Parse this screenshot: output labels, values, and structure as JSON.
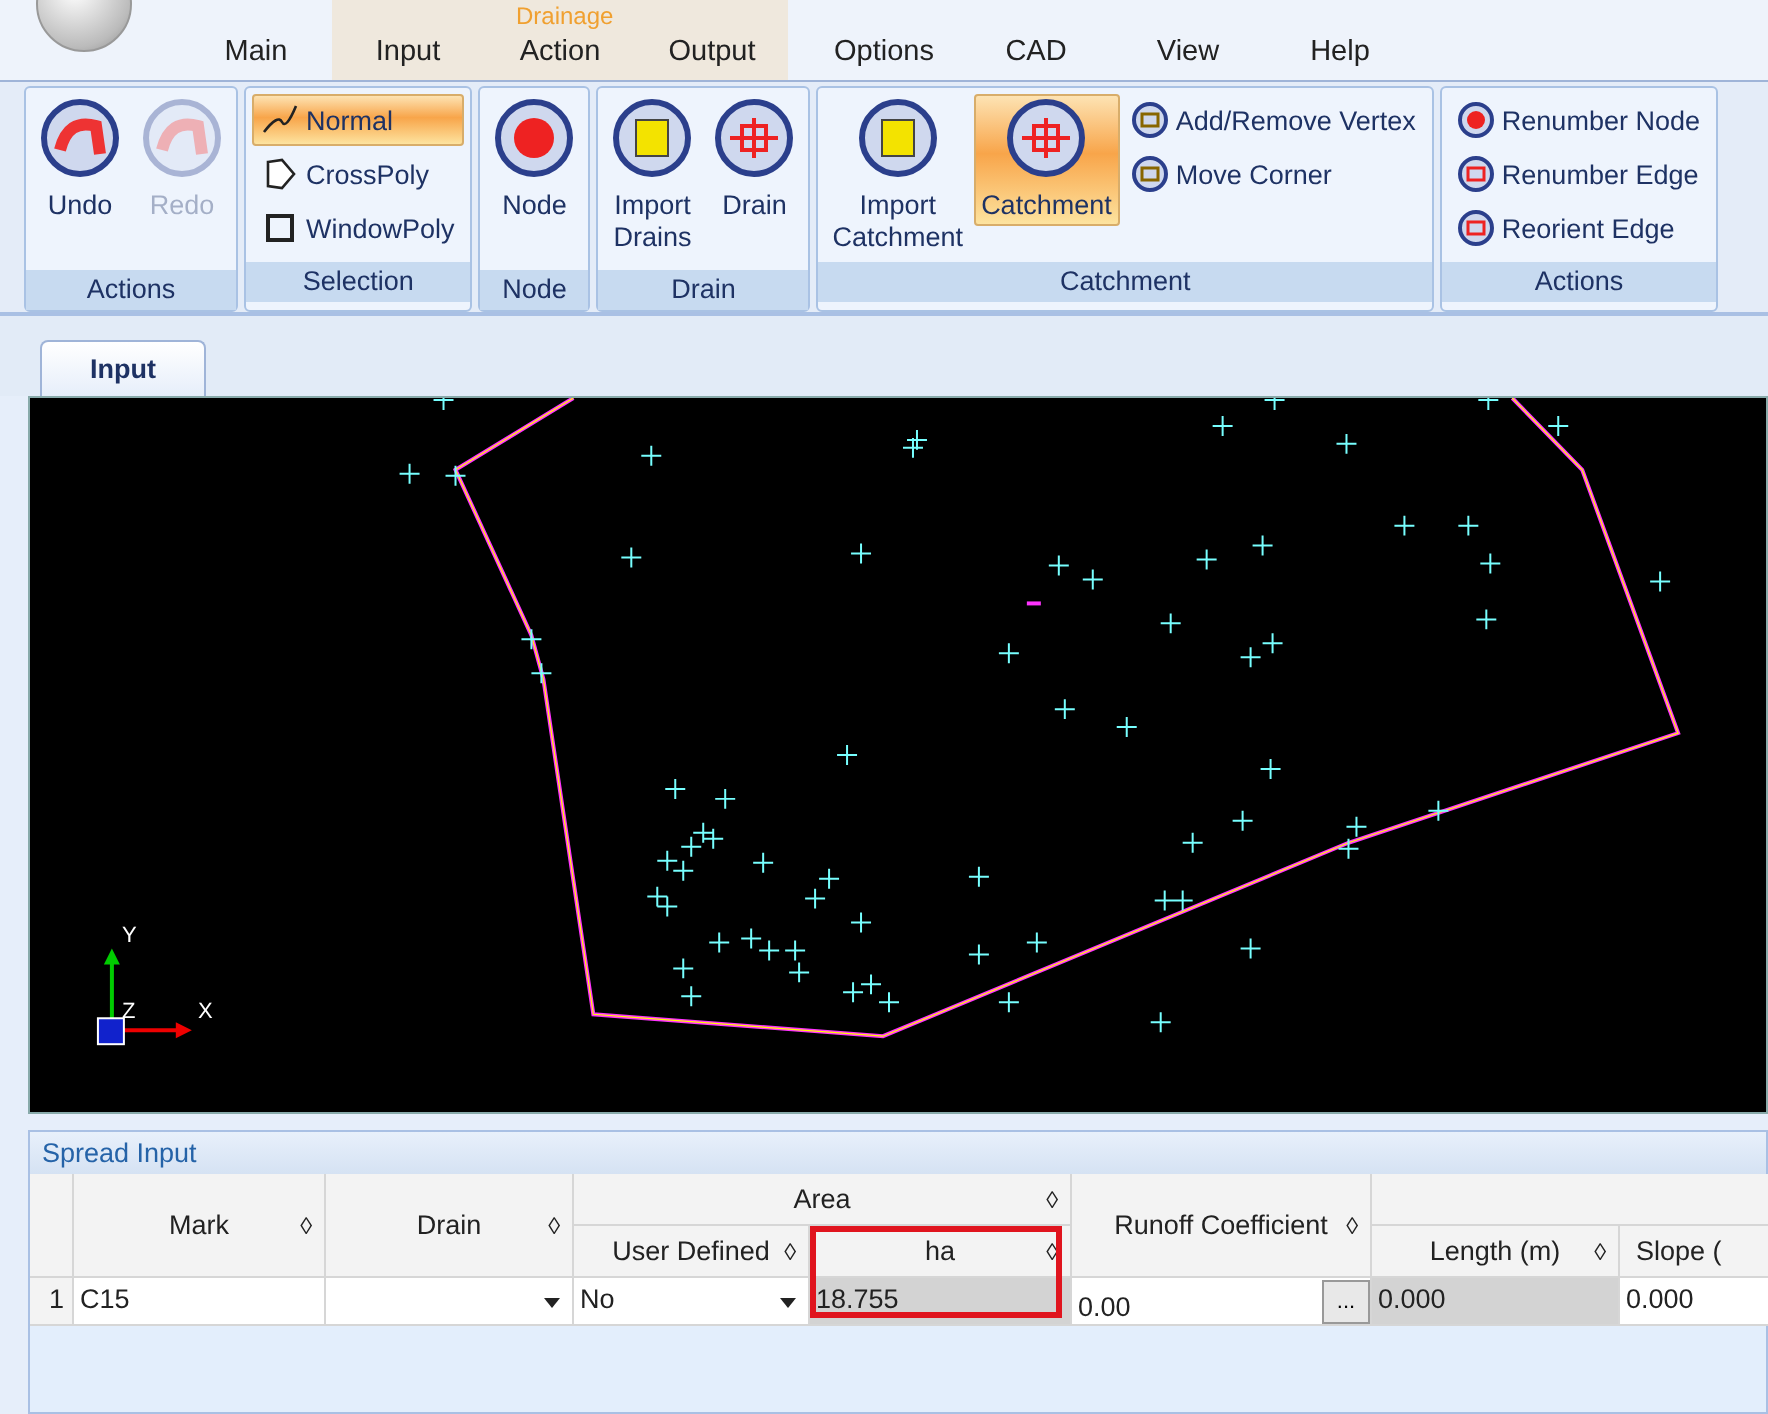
{
  "app": {
    "context_label": "Drainage"
  },
  "menu": [
    {
      "label": "Main",
      "contextual": false,
      "selected": false
    },
    {
      "label": "Input",
      "contextual": true,
      "selected": false
    },
    {
      "label": "Action",
      "contextual": true,
      "selected": false
    },
    {
      "label": "Output",
      "contextual": true,
      "selected": false
    },
    {
      "label": "Options",
      "contextual": false,
      "selected": false
    },
    {
      "label": "CAD",
      "contextual": false,
      "selected": false
    },
    {
      "label": "View",
      "contextual": false,
      "selected": false
    },
    {
      "label": "Help",
      "contextual": false,
      "selected": false
    }
  ],
  "ribbon": [
    {
      "title": "Actions",
      "items": [
        {
          "kind": "large",
          "label": "Undo",
          "disabled": false,
          "selected": false
        },
        {
          "kind": "large",
          "label": "Redo",
          "disabled": true,
          "selected": false
        }
      ]
    },
    {
      "title": "Selection",
      "items": [
        {
          "kind": "small",
          "label": "Normal",
          "disabled": false,
          "selected": true
        },
        {
          "kind": "small",
          "label": "CrossPoly",
          "disabled": false,
          "selected": false
        },
        {
          "kind": "small",
          "label": "WindowPoly",
          "disabled": false,
          "selected": false
        }
      ]
    },
    {
      "title": "Node",
      "items": [
        {
          "kind": "large",
          "label": "Node",
          "disabled": false,
          "selected": false
        }
      ]
    },
    {
      "title": "Drain",
      "items": [
        {
          "kind": "large",
          "label": "Import Drains",
          "disabled": false,
          "selected": false
        },
        {
          "kind": "large",
          "label": "Drain",
          "disabled": false,
          "selected": false
        }
      ]
    },
    {
      "title": "Catchment",
      "items": [
        {
          "kind": "large",
          "label": "Import Catchment",
          "disabled": false,
          "selected": false
        },
        {
          "kind": "large",
          "label": "Catchment",
          "disabled": false,
          "selected": true
        },
        {
          "kind": "small",
          "label": "Add/Remove Vertex",
          "disabled": false,
          "selected": false
        },
        {
          "kind": "small",
          "label": "Move Corner",
          "disabled": false,
          "selected": false
        }
      ]
    },
    {
      "title": "Actions",
      "items": [
        {
          "kind": "small",
          "label": "Renumber Node",
          "disabled": false,
          "selected": false
        },
        {
          "kind": "small",
          "label": "Renumber Edge",
          "disabled": false,
          "selected": false
        },
        {
          "kind": "small",
          "label": "Reorient Edge",
          "disabled": false,
          "selected": false
        }
      ]
    }
  ],
  "doc_tabs": [
    {
      "label": "Input",
      "selected": true
    }
  ],
  "canvas": {
    "axis_labels": [
      "Y",
      "Z",
      "X"
    ]
  },
  "spread": {
    "title": "Spread Input",
    "group_header": "Area",
    "sort_mark": "◊",
    "columns": [
      "Mark",
      "Drain",
      "User Defined",
      "ha",
      "Runoff Coefficient",
      "Length (m)",
      "Slope ("
    ],
    "rows": [
      {
        "number": "1",
        "mark": "C15",
        "user_defined": "No",
        "ha": "18.755",
        "runoff": "0.00",
        "browse": "...",
        "length": "0.000",
        "slope": "0.000"
      }
    ]
  }
}
